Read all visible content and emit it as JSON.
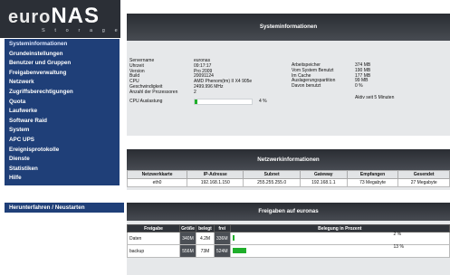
{
  "brand": {
    "main": "euro",
    "accent": "NAS",
    "tagline": "S t o r a g e"
  },
  "sidebar": {
    "items": [
      {
        "label": "Systeminformationen"
      },
      {
        "label": "Grundeinstellungen"
      },
      {
        "label": "Benutzer und Gruppen"
      },
      {
        "label": "Freigabenverwaltung"
      },
      {
        "label": "Netzwerk"
      },
      {
        "label": "Zugriffsberechtigungen"
      },
      {
        "label": "Quota"
      },
      {
        "label": "Laufwerke"
      },
      {
        "label": "Software Raid"
      },
      {
        "label": "System"
      },
      {
        "label": "APC UPS"
      },
      {
        "label": "Ereignisprotokolle"
      },
      {
        "label": "Dienste"
      },
      {
        "label": "Statistiken"
      },
      {
        "label": "Hilfe"
      }
    ],
    "shutdown_label": "Herunterfahren / Neustarten"
  },
  "system_panel": {
    "title": "Systeminformationen",
    "left_labels": [
      "Servername",
      "Uhrzeit",
      "Version",
      "Build",
      "CPU",
      "Geschwindigkeit",
      "Anzahl der Prozessoren"
    ],
    "left_values": [
      "euronas",
      "09:17:17",
      "Pro 2009",
      "20091124",
      "AMD Phenom(tm) II X4 905e",
      "2499.996 MHz",
      "2"
    ],
    "cpu_label": "CPU Auslastung",
    "cpu_percent_text": "4 %",
    "cpu_fraction": 0.04,
    "right_labels": [
      "Arbeitspeicher",
      "Vom System Benutzt",
      "Im Cache",
      "Auslagerungspartition",
      "Davon benutzt"
    ],
    "right_values": [
      "374 MB",
      "190 MB",
      "177 MB",
      "99 MB",
      "0 %"
    ],
    "uptime": "Aktiv seit 5 Minuten"
  },
  "network_panel": {
    "title": "Netzwerkinformationen",
    "columns": [
      "Netzwerkkarte",
      "IP-Adresse",
      "Subnet",
      "Gateway",
      "Empfangen",
      "Gesendet"
    ],
    "rows": [
      [
        "eth0",
        "192.168.1.150",
        "255.255.255.0",
        "192.168.1.1",
        "73 Megabyte",
        "27 Megabyte"
      ]
    ]
  },
  "shares_panel": {
    "title": "Freigaben auf euronas",
    "columns": [
      "Freigabe",
      "Größe",
      "belegt",
      "frei",
      "Belegung in Prozent"
    ],
    "rows": [
      {
        "name": "Daten",
        "size": "340M",
        "used": "4.2M",
        "free": "336M",
        "percent_text": "2 %",
        "fraction": 0.02
      },
      {
        "name": "backup",
        "size": "556M",
        "used": "73M",
        "free": "524M",
        "percent_text": "13 %",
        "fraction": 0.13
      }
    ]
  },
  "colors": {
    "nav_bg": "#1f3f78",
    "progress_fill": "#1fae2a",
    "header_dark": "#2a2d33"
  }
}
